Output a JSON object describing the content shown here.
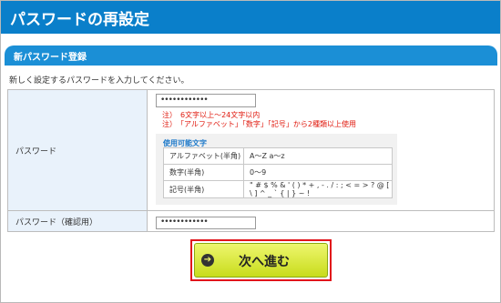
{
  "page": {
    "title": "パスワードの再設定"
  },
  "section": {
    "title": "新パスワード登録"
  },
  "intro": "新しく設定するパスワードを入力してください。",
  "form": {
    "password": {
      "label": "パスワード",
      "value": "••••••••••••",
      "notes": [
        "注）　6文字以上～24文字以内",
        "注）　「アルファベット」「数字」「記号」から2種類以上使用"
      ]
    },
    "allowed_chars": {
      "title": "使用可能文字",
      "rows": [
        {
          "type": "アルファベット(半角)",
          "chars": "A～Z a～z"
        },
        {
          "type": "数字(半角)",
          "chars": "0～9"
        },
        {
          "type": "記号(半角)",
          "chars": "\" # $ % & ' ( ) * + , - . / : ; < = > ? @ [ \\ ] ^ _ ` { | } ~ !"
        }
      ]
    },
    "confirm": {
      "label": "パスワード（確認用）",
      "value": "••••••••••••"
    }
  },
  "button": {
    "label": "次へ進む",
    "icon": "arrow-right-icon"
  }
}
